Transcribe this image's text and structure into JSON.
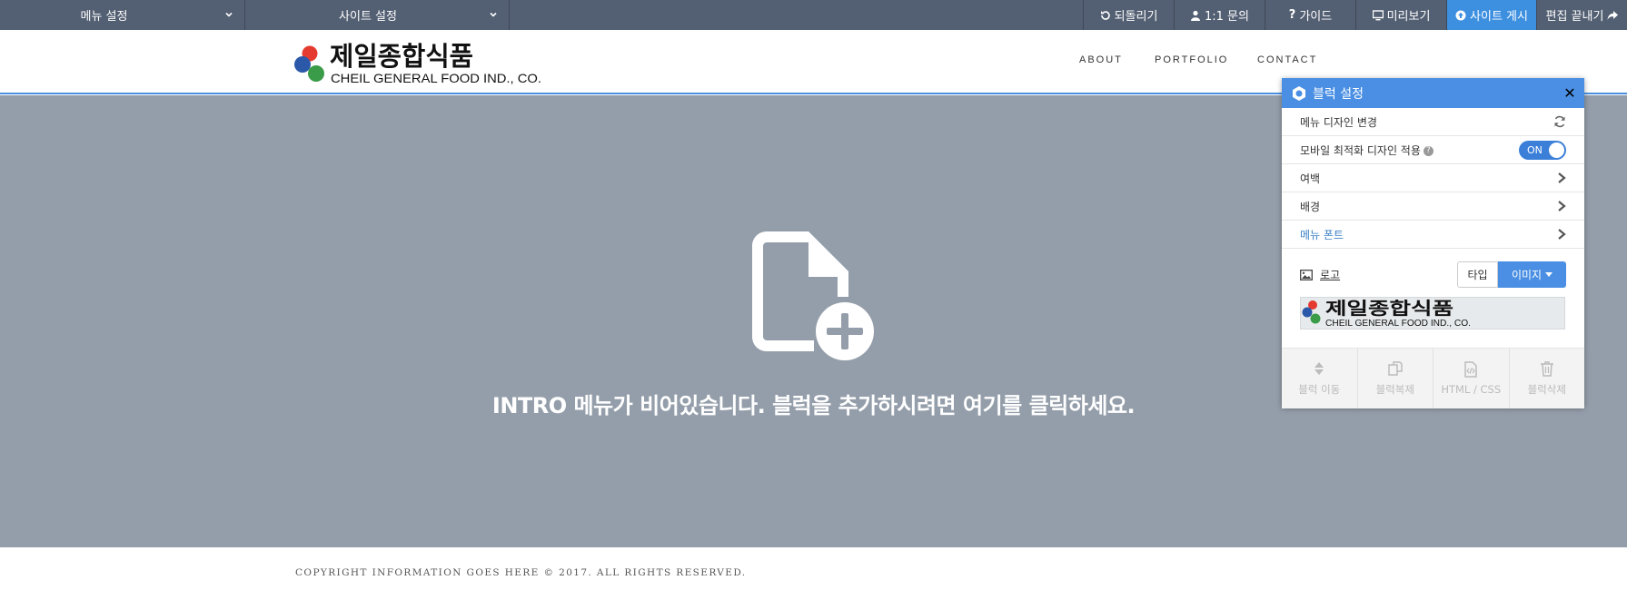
{
  "topbar": {
    "menu_settings": "메뉴 설정",
    "site_settings": "사이트 설정",
    "undo": "되돌리기",
    "inquiry": "1:1 문의",
    "guide": "가이드",
    "preview": "미리보기",
    "publish": "사이트 게시",
    "finish": "편집 끝내기"
  },
  "header": {
    "logo_korean": "제일종합식품",
    "logo_english": "CHEIL GENERAL FOOD IND., CO.",
    "nav": [
      "ABOUT",
      "PORTFOLIO",
      "CONTACT"
    ]
  },
  "intro": {
    "message": "INTRO 메뉴가 비어있습니다. 블럭을 추가하시려면 여기를 클릭하세요."
  },
  "footer": {
    "copyright": "COPYRIGHT INFORMATION GOES HERE © 2017. ALL RIGHTS RESERVED."
  },
  "panel": {
    "title": "블럭 설정",
    "close": "✕",
    "rows": {
      "menu_design": "메뉴 디자인 변경",
      "mobile_opt": "모바일 최적화 디자인 적용",
      "mobile_toggle": "ON",
      "margin": "여백",
      "background": "배경",
      "menu_font": "메뉴 폰트"
    },
    "logo": {
      "label": "로고",
      "type_option": "타입",
      "image_option": "이미지",
      "preview_korean": "제일종합식품",
      "preview_english": "CHEIL GENERAL FOOD IND., CO."
    },
    "actions": {
      "move": "블럭 이동",
      "copy": "블럭복제",
      "html_css": "HTML / CSS",
      "delete": "블럭삭제"
    }
  },
  "colors": {
    "topbar": "#535f72",
    "accent": "#4a8fe3",
    "intro_bg": "#949eaa"
  }
}
